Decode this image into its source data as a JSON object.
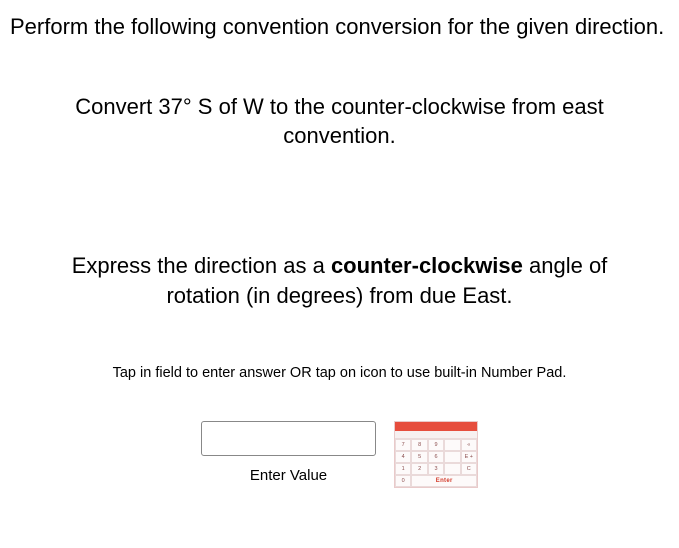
{
  "instruction": "Perform the following convention conversion for the given direction.",
  "problem": "Convert 37° S of W to the counter-clockwise from east convention.",
  "prompt_pre": "Express the direction as a ",
  "prompt_bold": "counter-clockwise",
  "prompt_post": " angle of rotation (in degrees) from due East.",
  "hint": "Tap in field to enter answer OR tap on icon to use built-in Number Pad.",
  "input": {
    "value": "",
    "label": "Enter Value"
  },
  "numpad": {
    "keys_row1": [
      "7",
      "8",
      "9",
      "",
      "«"
    ],
    "keys_row2": [
      "4",
      "5",
      "6",
      "",
      "E\n+"
    ],
    "keys_row3": [
      "1",
      "2",
      "3",
      "",
      "C"
    ],
    "keys_row4_first": "0",
    "enter_label": "Enter"
  }
}
